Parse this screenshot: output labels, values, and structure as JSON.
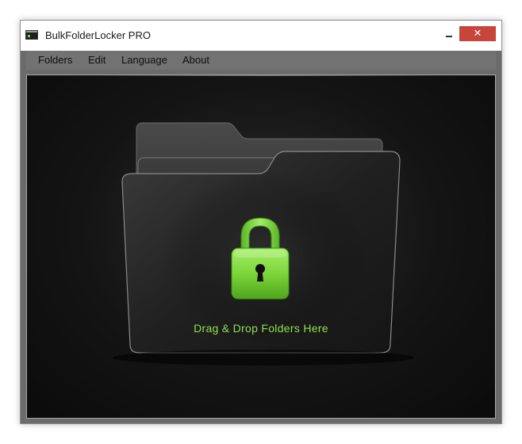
{
  "window": {
    "title": "BulkFolderLocker PRO",
    "close_symbol": "✕"
  },
  "menu": {
    "items": [
      {
        "label": "Folders"
      },
      {
        "label": "Edit"
      },
      {
        "label": "Language"
      },
      {
        "label": "About"
      }
    ]
  },
  "dropzone": {
    "text": "Drag & Drop Folders Here"
  },
  "icons": {
    "app": "app-icon",
    "minimize": "minimize-icon",
    "close": "close-icon",
    "folder": "folder-icon",
    "lock": "padlock-icon"
  },
  "colors": {
    "accent": "#8ee04f",
    "lock_green": "#7cd63a",
    "close_red": "#c8453b",
    "content_bg": "#141414"
  }
}
